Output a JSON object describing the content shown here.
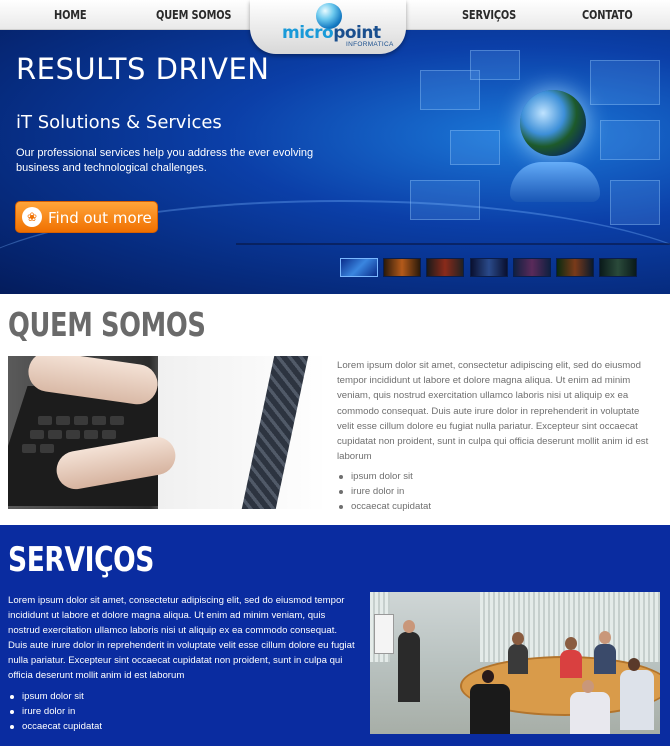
{
  "nav": {
    "items": [
      {
        "label": "HOME"
      },
      {
        "label": "QUEM SOMOS"
      },
      {
        "label": "SERVIÇOS"
      },
      {
        "label": "CONTATO"
      }
    ],
    "logo": {
      "part1": "micro",
      "part2": "point",
      "sub": "INFORMATICA"
    }
  },
  "hero": {
    "title": "RESULTS DRIVEN",
    "subtitle": "iT Solutions & Services",
    "text": "Our professional services help you address the ever evolving business and technological challenges.",
    "button": "Find out more",
    "thumbnails_count": 7,
    "active_thumbnail": 1
  },
  "quem_somos": {
    "title": "QUEM SOMOS",
    "paragraph": "Lorem ipsum dolor sit amet, consectetur adipiscing elit, sed do eiusmod tempor incididunt ut labore et dolore magna aliqua. Ut enim ad minim veniam, quis nostrud exercitation ullamco laboris nisi ut aliquip ex ea commodo consequat. Duis aute irure dolor in reprehenderit in voluptate velit esse cillum dolore eu fugiat nulla pariatur. Excepteur sint occaecat cupidatat non proident, sunt in culpa qui officia deserunt mollit anim id est laborum",
    "list": [
      "ipsum dolor sit",
      "irure dolor in",
      "occaecat cupidatat"
    ]
  },
  "servicos": {
    "title": "SERVIÇOS",
    "paragraph": "Lorem ipsum dolor sit amet, consectetur adipiscing elit, sed do eiusmod tempor incididunt ut labore et dolore magna aliqua. Ut enim ad minim veniam, quis nostrud exercitation ullamco laboris nisi ut aliquip ex ea commodo consequat. Duis aute irure dolor in reprehenderit in voluptate velit esse cillum dolore eu fugiat nulla pariatur. Excepteur sint occaecat cupidatat non proident, sunt in culpa qui officia deserunt mollit anim id est laborum",
    "list": [
      "ipsum dolor sit",
      "irure dolor in",
      "occaecat cupidatat"
    ]
  },
  "colors": {
    "hero_blue": "#0b3fa8",
    "servicos_bg": "#0a2ca0",
    "button_orange": "#f07000",
    "heading_gray": "#6a6a6a",
    "logo_light": "#1a9ad8",
    "logo_dark": "#1a4f8e"
  },
  "icons": {
    "button_icon": "paw-icon",
    "logo_icon": "globe-icon"
  }
}
